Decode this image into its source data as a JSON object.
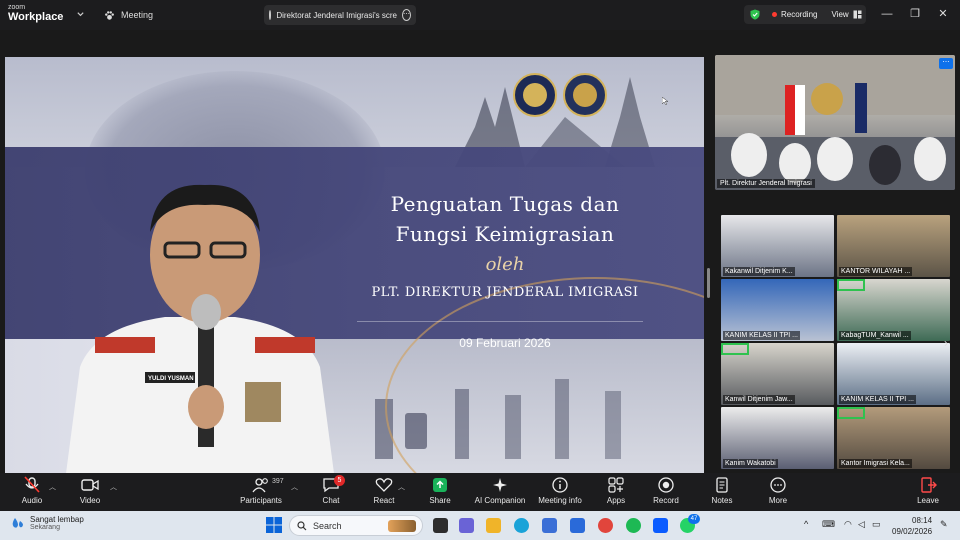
{
  "app": {
    "brand_small": "zoom",
    "brand_big": "Workplace"
  },
  "tabs": {
    "meeting": "Meeting",
    "share": "Direktorat Jenderal Imigrasi's scre"
  },
  "status": {
    "recording": "Recording",
    "view": "View"
  },
  "slide": {
    "title_line1": "Penguatan Tugas dan",
    "title_line2": "Fungsi Keimigrasian",
    "oleh": "oleh",
    "subtitle": "PLT. DIREKTUR JENDERAL IMIGRASI",
    "date": "09 Februari 2026",
    "nametag": "YULDI YUSMAN"
  },
  "host": {
    "label": "Plt. Direktur Jenderal Imigrasi"
  },
  "gallery": [
    {
      "label": "Kakanwil Ditjenim K...",
      "highlight": false
    },
    {
      "label": "KANTOR WILAYAH ...",
      "highlight": false
    },
    {
      "label": "KANIM KELAS II TPI ...",
      "highlight": false
    },
    {
      "label": "KabagTUM_Kanwil ...",
      "highlight": true
    },
    {
      "label": "Kanwil Ditjenim Jaw...",
      "highlight": true
    },
    {
      "label": "KANIM KELAS II TPI ...",
      "highlight": false
    },
    {
      "label": "Kanim Wakatobi",
      "highlight": false
    },
    {
      "label": "Kantor Imigrasi Kela...",
      "highlight": true
    }
  ],
  "toolbar": {
    "audio": "Audio",
    "video": "Video",
    "participants": "Participants",
    "participants_count": "397",
    "chat": "Chat",
    "chat_badge": "5",
    "react": "React",
    "share": "Share",
    "ai": "AI Companion",
    "info": "Meeting info",
    "apps": "Apps",
    "record": "Record",
    "notes": "Notes",
    "more": "More",
    "leave": "Leave"
  },
  "taskbar": {
    "weather_title": "Sangat lembap",
    "weather_sub": "Sekarang",
    "search_placeholder": "Search",
    "whatsapp_badge": "47",
    "time": "08:14",
    "date": "09/02/2026"
  },
  "colors": {
    "accent": "#0e71eb",
    "share_green": "#19b25a",
    "record_red": "#ff3b30",
    "slide_band": "#45477a"
  }
}
